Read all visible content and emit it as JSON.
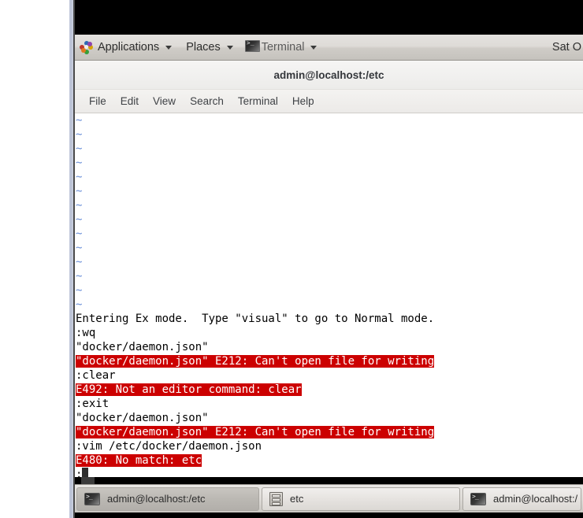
{
  "panel": {
    "applications_label": "Applications",
    "places_label": "Places",
    "window_label": "Terminal",
    "clock": "Sat O",
    "applications_icon": "fedora-pinwheel-icon",
    "window_icon": "terminal-icon",
    "menu_arrow_icon": "chevron-down-icon"
  },
  "terminal_window": {
    "title": "admin@localhost:/etc",
    "menus": [
      "File",
      "Edit",
      "View",
      "Search",
      "Terminal",
      "Help"
    ]
  },
  "terminal_screen": {
    "tilde_glyph": "~",
    "tilde_count": 14,
    "lines": [
      {
        "type": "plain",
        "text": "Entering Ex mode.  Type \"visual\" to go to Normal mode."
      },
      {
        "type": "plain",
        "text": ":wq"
      },
      {
        "type": "plain",
        "text": "\"docker/daemon.json\""
      },
      {
        "type": "error",
        "text": "\"docker/daemon.json\" E212: Can't open file for writing"
      },
      {
        "type": "plain",
        "text": ":clear"
      },
      {
        "type": "error",
        "text": "E492: Not an editor command: clear"
      },
      {
        "type": "plain",
        "text": ":exit"
      },
      {
        "type": "plain",
        "text": "\"docker/daemon.json\""
      },
      {
        "type": "error",
        "text": "\"docker/daemon.json\" E212: Can't open file for writing"
      },
      {
        "type": "plain",
        "text": ":vim /etc/docker/daemon.json"
      },
      {
        "type": "error",
        "text": "E480: No match: etc"
      }
    ],
    "prompt": ":",
    "cursor": "block-cursor"
  },
  "taskbar": {
    "items": [
      {
        "label": "admin@localhost:/etc",
        "icon": "terminal-icon",
        "state": "active"
      },
      {
        "label": "etc",
        "icon": "file-cabinet-icon",
        "state": "inactive"
      },
      {
        "label": "admin@localhost:/",
        "icon": "terminal-icon",
        "state": "inactive"
      }
    ]
  },
  "colors": {
    "error_background": "#cc0000",
    "error_foreground": "#ffffff",
    "tilde": "#6a8fd8",
    "terminal_background": "#ffffff",
    "terminal_foreground": "#000000"
  }
}
